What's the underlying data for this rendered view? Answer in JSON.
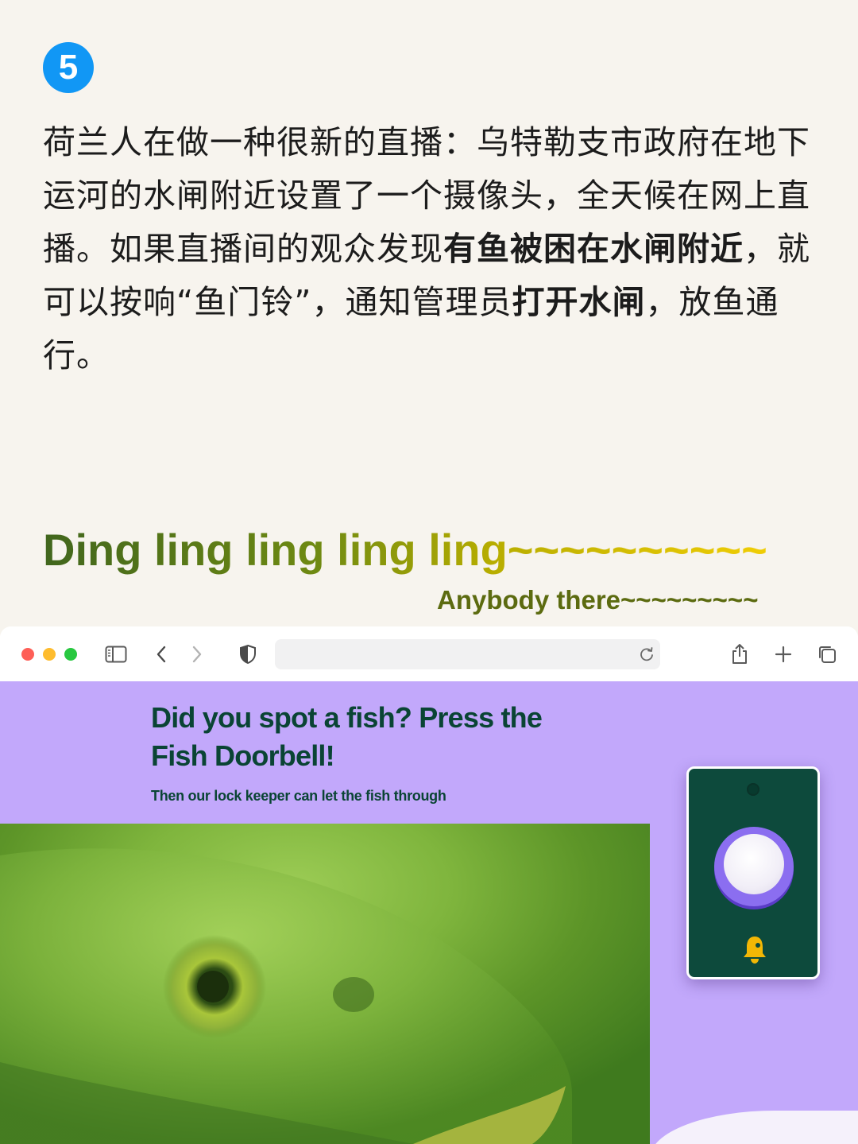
{
  "step_number": "5",
  "intro": {
    "segments": [
      {
        "text": "荷兰人在做一种很新的直播：乌特勒支市政府在地下运河的水闸附近设置了一个摄像头，全天候在网上直播。如果直播间的观众发现",
        "bold": false
      },
      {
        "text": "有鱼被困在水闸附近",
        "bold": true
      },
      {
        "text": "，就可以按响“鱼门铃”，通知管理员",
        "bold": false
      },
      {
        "text": "打开水闸",
        "bold": true
      },
      {
        "text": "，放鱼通行。",
        "bold": false
      }
    ]
  },
  "ding_text": "Ding ling ling ling ling~~~~~~~~~~",
  "anybody_text": "Anybody there~~~~~~~~~",
  "browser": {
    "address_value": "",
    "icons": [
      "sidebar-icon",
      "back-icon",
      "forward-icon",
      "privacy-shield-icon",
      "reload-icon",
      "share-icon",
      "new-tab-icon",
      "tab-overview-icon"
    ]
  },
  "page": {
    "headline": "Did you spot a fish? Press the Fish Doorbell!",
    "subline": "Then our lock keeper can let the fish through"
  },
  "colors": {
    "badge": "#1197f5",
    "page_background": "#c2a8fb",
    "headline": "#0a4434",
    "doorbell": "#0d4a3c",
    "bell": "#f2b705"
  }
}
